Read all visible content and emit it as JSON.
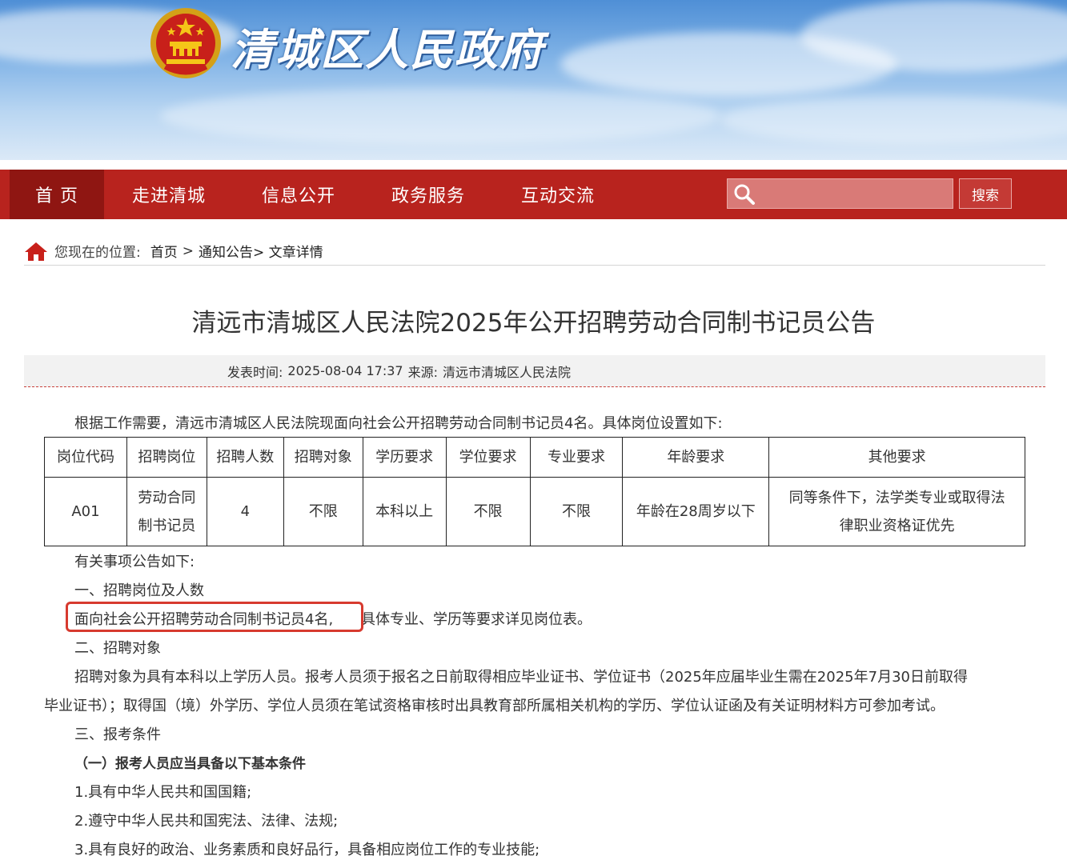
{
  "header": {
    "site_title": "清城区人民政府"
  },
  "nav": {
    "items": [
      "首 页",
      "走进清城",
      "信息公开",
      "政务服务",
      "互动交流"
    ],
    "search_placeholder": "",
    "search_button": "搜索",
    "colors": {
      "bar": "#b8231e",
      "active": "#8f1612"
    }
  },
  "breadcrumb": {
    "label": "您现在的位置:",
    "home": "首页",
    "sep": ">",
    "trail": "通知公告> 文章详情"
  },
  "article": {
    "title": "清远市清城区人民法院2025年公开招聘劳动合同制书记员公告",
    "meta_time_label": "发表时间:",
    "meta_time": "2025-08-04 17:37",
    "meta_source_label": "来源:",
    "meta_source": "清远市清城区人民法院",
    "intro": "根据工作需要，清远市清城区人民法院现面向社会公开招聘劳动合同制书记员4名。具体岗位设置如下:",
    "table": {
      "headers": [
        "岗位代码",
        "招聘岗位",
        "招聘人数",
        "招聘对象",
        "学历要求",
        "学位要求",
        "专业要求",
        "年龄要求",
        "其他要求"
      ],
      "row": {
        "code": "A01",
        "position_line1": "劳动合同",
        "position_line2": "制书记员",
        "count": "4",
        "target": "不限",
        "education": "本科以上",
        "degree": "不限",
        "major": "不限",
        "age": "年龄在28周岁以下",
        "other_line1": "同等条件下，法学类专业或取得法",
        "other_line2": "律职业资格证优先"
      }
    },
    "notice_heading": "有关事项公告如下:",
    "s1_heading": "一、招聘岗位及人数",
    "s1_highlight": "面向社会公开招聘劳动合同制书记员4名,",
    "s1_rest": "具体专业、学历等要求详见岗位表。",
    "s2_heading": "二、招聘对象",
    "s2_line1": "招聘对象为具有本科以上学历人员。报考人员须于报名之日前取得相应毕业证书、学位证书（2025年应届毕业生需在2025年7月30日前取得",
    "s2_line2": "毕业证书）；取得国（境）外学历、学位人员须在笔试资格审核时出具教育部所属相关机构的学历、学位认证函及有关证明材料方可参加考试。",
    "s3_heading": "三、报考条件",
    "s3_sub": "（一）报考人员应当具备以下基本条件",
    "cond1": "1.具有中华人民共和国国籍;",
    "cond2": "2.遵守中华人民共和国宪法、法律、法规;",
    "cond3": "3.具有良好的政治、业务素质和良好品行，具备相应岗位工作的专业技能;"
  }
}
